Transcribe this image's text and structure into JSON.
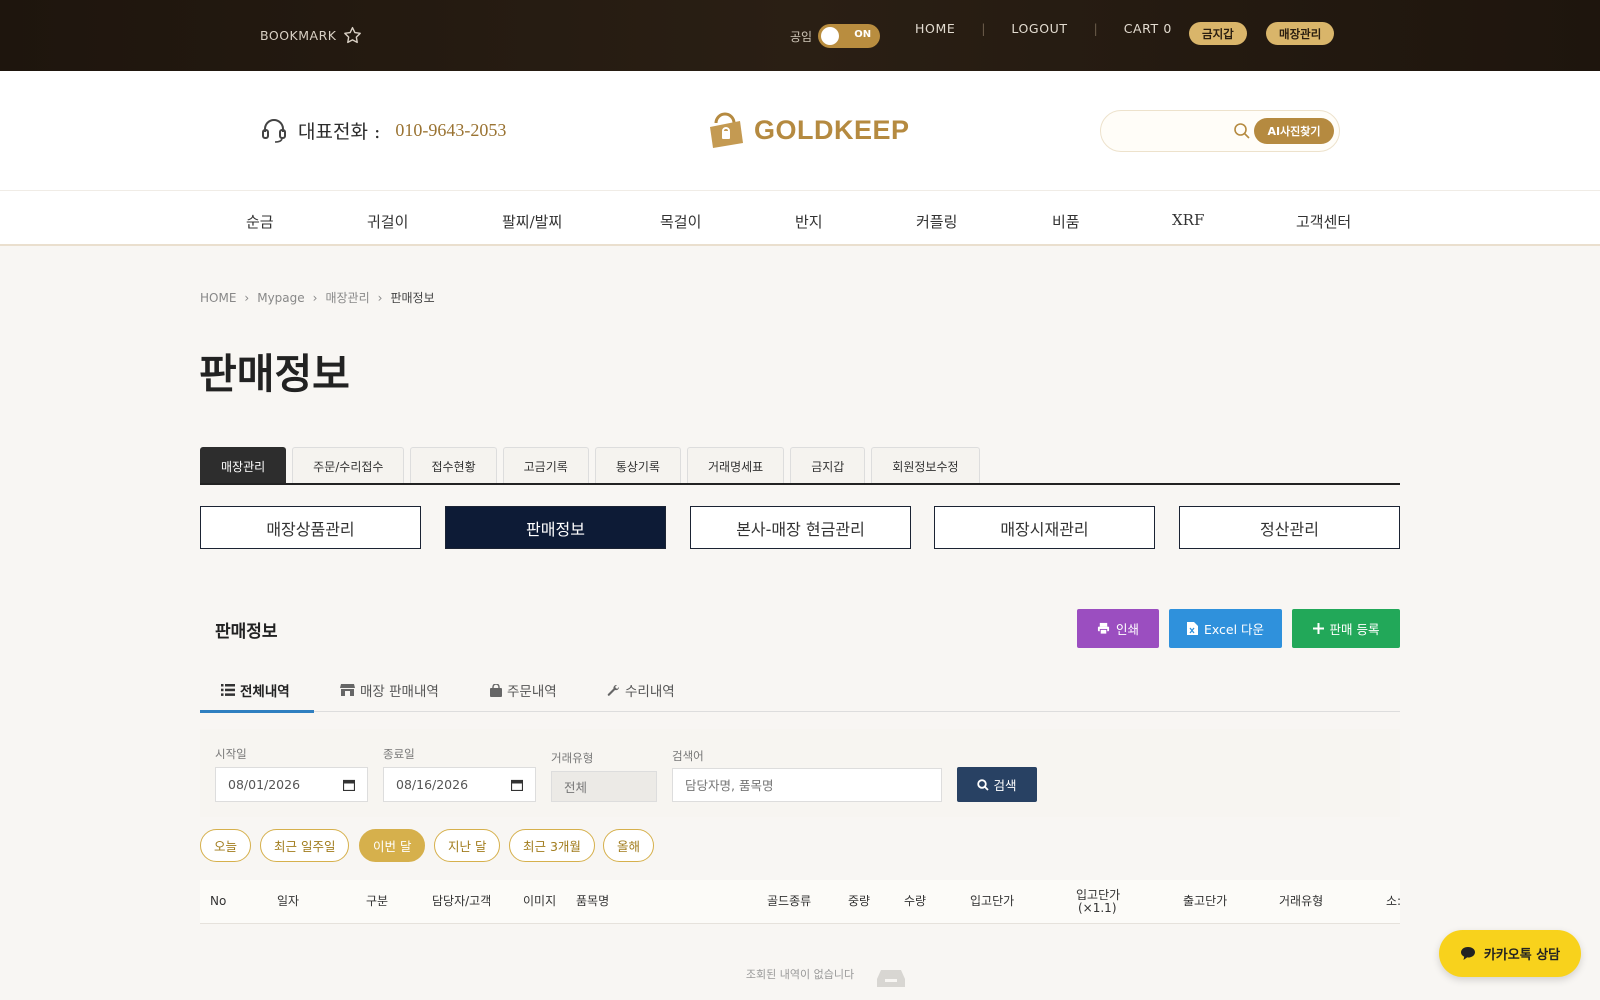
{
  "topbar": {
    "bookmark": "BOOKMARK",
    "mode_label": "공임",
    "toggle_state": "ON",
    "links": [
      "HOME",
      "LOGOUT",
      "CART 0"
    ],
    "pill_gold": "금지갑",
    "pill_store": "매장관리"
  },
  "header": {
    "phone_label": "대표전화 :",
    "phone_number": "010-9643-2053",
    "logo": "GOLDKEEP",
    "search_placeholder": "",
    "ai_button": "AI사진찾기"
  },
  "nav": [
    "순금",
    "귀걸이",
    "팔찌/발찌",
    "목걸이",
    "반지",
    "커플링",
    "비품",
    "XRF",
    "고객센터"
  ],
  "breadcrumb": [
    "HOME",
    "Mypage",
    "매장관리",
    "판매정보"
  ],
  "page_title": "판매정보",
  "tabs": [
    "매장관리",
    "주문/수리접수",
    "접수현황",
    "고금기록",
    "통상기록",
    "거래명세표",
    "금지갑",
    "회원정보수정"
  ],
  "subbuttons": [
    "매장상품관리",
    "판매정보",
    "본사-매장 현금관리",
    "매장시재관리",
    "정산관리"
  ],
  "section": {
    "title": "판매정보",
    "print": "인쇄",
    "excel": "Excel 다운",
    "add": "판매 등록"
  },
  "subtabs": [
    "전체내역",
    "매장 판매내역",
    "주문내역",
    "수리내역"
  ],
  "filter": {
    "start_label": "시작일",
    "start_value": "08/01/2026",
    "end_label": "종료일",
    "end_value": "08/16/2026",
    "type_label": "거래유형",
    "type_value": "전체",
    "keyword_label": "검색어",
    "keyword_placeholder": "담당자명, 품목명",
    "search_button": "검색"
  },
  "quick_ranges": [
    "오늘",
    "최근 일주일",
    "이번 달",
    "지난 달",
    "최근 3개월",
    "올해"
  ],
  "table": {
    "headers": [
      "No",
      "일자",
      "구분",
      "담당자/고객",
      "이미지",
      "품목명",
      "골드종류",
      "중량",
      "수량",
      "입고단가",
      "입고단가",
      "(×1.1)",
      "출고단가",
      "거래유형",
      "소:"
    ],
    "empty_text": "조회된 내역이 없습니다"
  },
  "kakao": "카카오톡 상담",
  "colors": {
    "accent_gold": "#b58a40",
    "nav_dark": "#0d1b36",
    "print": "#9b4ec0",
    "excel": "#2f91dc",
    "add": "#22a859",
    "kakao": "#f8d21c"
  }
}
